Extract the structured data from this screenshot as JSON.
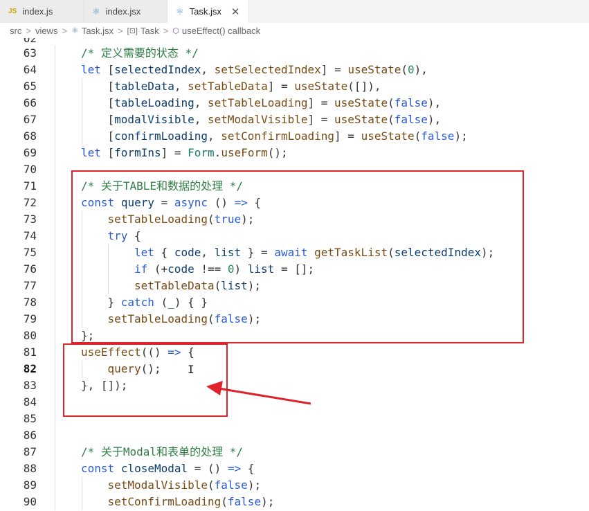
{
  "tabs": [
    {
      "icon": "JS",
      "label": "index.js"
    },
    {
      "icon": "react-icon",
      "label": "index.jsx"
    },
    {
      "icon": "react-icon",
      "label": "Task.jsx",
      "active": true,
      "close": "✕"
    }
  ],
  "breadcrumb": {
    "items": [
      "src",
      "views",
      "Task.jsx",
      "Task",
      "useEffect() callback"
    ],
    "separator": ">"
  },
  "editor": {
    "active_line": "82",
    "top_peek": "62",
    "lines": [
      {
        "n": "63",
        "indent": 1,
        "tokens": [
          [
            "comment",
            "/* 定义需要的状态 */"
          ]
        ]
      },
      {
        "n": "64",
        "indent": 1,
        "tokens": [
          [
            "kw",
            "let"
          ],
          [
            "pun",
            " ["
          ],
          [
            "var",
            "selectedIndex"
          ],
          [
            "pun",
            ", "
          ],
          [
            "fn",
            "setSelectedIndex"
          ],
          [
            "pun",
            "] = "
          ],
          [
            "fn",
            "useState"
          ],
          [
            "pun",
            "("
          ],
          [
            "num",
            "0"
          ],
          [
            "pun",
            "),"
          ]
        ]
      },
      {
        "n": "65",
        "indent": 2,
        "tokens": [
          [
            "pun",
            "["
          ],
          [
            "var",
            "tableData"
          ],
          [
            "pun",
            ", "
          ],
          [
            "fn",
            "setTableData"
          ],
          [
            "pun",
            "] = "
          ],
          [
            "fn",
            "useState"
          ],
          [
            "pun",
            "([]),"
          ]
        ]
      },
      {
        "n": "66",
        "indent": 2,
        "tokens": [
          [
            "pun",
            "["
          ],
          [
            "var",
            "tableLoading"
          ],
          [
            "pun",
            ", "
          ],
          [
            "fn",
            "setTableLoading"
          ],
          [
            "pun",
            "] = "
          ],
          [
            "fn",
            "useState"
          ],
          [
            "pun",
            "("
          ],
          [
            "bool",
            "false"
          ],
          [
            "pun",
            "),"
          ]
        ]
      },
      {
        "n": "67",
        "indent": 2,
        "tokens": [
          [
            "pun",
            "["
          ],
          [
            "var",
            "modalVisible"
          ],
          [
            "pun",
            ", "
          ],
          [
            "fn",
            "setModalVisible"
          ],
          [
            "pun",
            "] = "
          ],
          [
            "fn",
            "useState"
          ],
          [
            "pun",
            "("
          ],
          [
            "bool",
            "false"
          ],
          [
            "pun",
            "),"
          ]
        ]
      },
      {
        "n": "68",
        "indent": 2,
        "tokens": [
          [
            "pun",
            "["
          ],
          [
            "var",
            "confirmLoading"
          ],
          [
            "pun",
            ", "
          ],
          [
            "fn",
            "setConfirmLoading"
          ],
          [
            "pun",
            "] = "
          ],
          [
            "fn",
            "useState"
          ],
          [
            "pun",
            "("
          ],
          [
            "bool",
            "false"
          ],
          [
            "pun",
            ");"
          ]
        ]
      },
      {
        "n": "69",
        "indent": 1,
        "tokens": [
          [
            "kw",
            "let"
          ],
          [
            "pun",
            " ["
          ],
          [
            "var",
            "formIns"
          ],
          [
            "pun",
            "] = "
          ],
          [
            "cls",
            "Form"
          ],
          [
            "pun",
            "."
          ],
          [
            "fn",
            "useForm"
          ],
          [
            "pun",
            "();"
          ]
        ]
      },
      {
        "n": "70",
        "indent": 1,
        "tokens": []
      },
      {
        "n": "71",
        "indent": 1,
        "tokens": [
          [
            "comment",
            "/* 关于TABLE和数据的处理 */"
          ]
        ]
      },
      {
        "n": "72",
        "indent": 1,
        "tokens": [
          [
            "kw",
            "const"
          ],
          [
            "pun",
            " "
          ],
          [
            "var",
            "query"
          ],
          [
            "pun",
            " = "
          ],
          [
            "kw",
            "async"
          ],
          [
            "pun",
            " () "
          ],
          [
            "kw",
            "=>"
          ],
          [
            "pun",
            " {"
          ]
        ]
      },
      {
        "n": "73",
        "indent": 2,
        "tokens": [
          [
            "fn",
            "setTableLoading"
          ],
          [
            "pun",
            "("
          ],
          [
            "bool",
            "true"
          ],
          [
            "pun",
            ");"
          ]
        ]
      },
      {
        "n": "74",
        "indent": 2,
        "tokens": [
          [
            "kw",
            "try"
          ],
          [
            "pun",
            " {"
          ]
        ]
      },
      {
        "n": "75",
        "indent": 3,
        "tokens": [
          [
            "kw",
            "let"
          ],
          [
            "pun",
            " { "
          ],
          [
            "var",
            "code"
          ],
          [
            "pun",
            ", "
          ],
          [
            "var",
            "list"
          ],
          [
            "pun",
            " } = "
          ],
          [
            "kw",
            "await"
          ],
          [
            "pun",
            " "
          ],
          [
            "fn",
            "getTaskList"
          ],
          [
            "pun",
            "("
          ],
          [
            "var",
            "selectedIndex"
          ],
          [
            "pun",
            ");"
          ]
        ]
      },
      {
        "n": "76",
        "indent": 3,
        "tokens": [
          [
            "kw",
            "if"
          ],
          [
            "pun",
            " (+"
          ],
          [
            "var",
            "code"
          ],
          [
            "pun",
            " !== "
          ],
          [
            "num",
            "0"
          ],
          [
            "pun",
            ") "
          ],
          [
            "var",
            "list"
          ],
          [
            "pun",
            " = [];"
          ]
        ]
      },
      {
        "n": "77",
        "indent": 3,
        "tokens": [
          [
            "fn",
            "setTableData"
          ],
          [
            "pun",
            "("
          ],
          [
            "var",
            "list"
          ],
          [
            "pun",
            ");"
          ]
        ]
      },
      {
        "n": "78",
        "indent": 2,
        "tokens": [
          [
            "pun",
            "} "
          ],
          [
            "kw",
            "catch"
          ],
          [
            "pun",
            " ("
          ],
          [
            "var",
            "_"
          ],
          [
            "pun",
            ") { }"
          ]
        ]
      },
      {
        "n": "79",
        "indent": 2,
        "tokens": [
          [
            "fn",
            "setTableLoading"
          ],
          [
            "pun",
            "("
          ],
          [
            "bool",
            "false"
          ],
          [
            "pun",
            ");"
          ]
        ]
      },
      {
        "n": "80",
        "indent": 1,
        "tokens": [
          [
            "pun",
            "};"
          ]
        ]
      },
      {
        "n": "81",
        "indent": 1,
        "tokens": [
          [
            "fn",
            "useEffect"
          ],
          [
            "pun",
            "(() "
          ],
          [
            "kw",
            "=>"
          ],
          [
            "pun",
            " {"
          ]
        ]
      },
      {
        "n": "82",
        "indent": 2,
        "tokens": [
          [
            "fn",
            "query"
          ],
          [
            "pun",
            "();"
          ]
        ]
      },
      {
        "n": "83",
        "indent": 1,
        "tokens": [
          [
            "pun",
            "}, []);"
          ]
        ]
      },
      {
        "n": "84",
        "indent": 1,
        "tokens": []
      },
      {
        "n": "85",
        "indent": 1,
        "tokens": []
      },
      {
        "n": "86",
        "indent": 1,
        "tokens": []
      },
      {
        "n": "87",
        "indent": 1,
        "tokens": [
          [
            "comment",
            "/* 关于Modal和表单的处理 */"
          ]
        ]
      },
      {
        "n": "88",
        "indent": 1,
        "tokens": [
          [
            "kw",
            "const"
          ],
          [
            "pun",
            " "
          ],
          [
            "var",
            "closeModal"
          ],
          [
            "pun",
            " = () "
          ],
          [
            "kw",
            "=>"
          ],
          [
            "pun",
            " {"
          ]
        ]
      },
      {
        "n": "89",
        "indent": 2,
        "tokens": [
          [
            "fn",
            "setModalVisible"
          ],
          [
            "pun",
            "("
          ],
          [
            "bool",
            "false"
          ],
          [
            "pun",
            ");"
          ]
        ]
      },
      {
        "n": "90",
        "indent": 2,
        "tokens": [
          [
            "fn",
            "setConfirmLoading"
          ],
          [
            "pun",
            "("
          ],
          [
            "bool",
            "false"
          ],
          [
            "pun",
            ");"
          ]
        ]
      }
    ]
  },
  "cursor_glyph": "I",
  "colors": {
    "annotation_red": "#e0222a",
    "comment": "#2f7d46",
    "keyword": "#2a5bd7",
    "function": "#7a4a12",
    "variable": "#0b3d6f"
  }
}
